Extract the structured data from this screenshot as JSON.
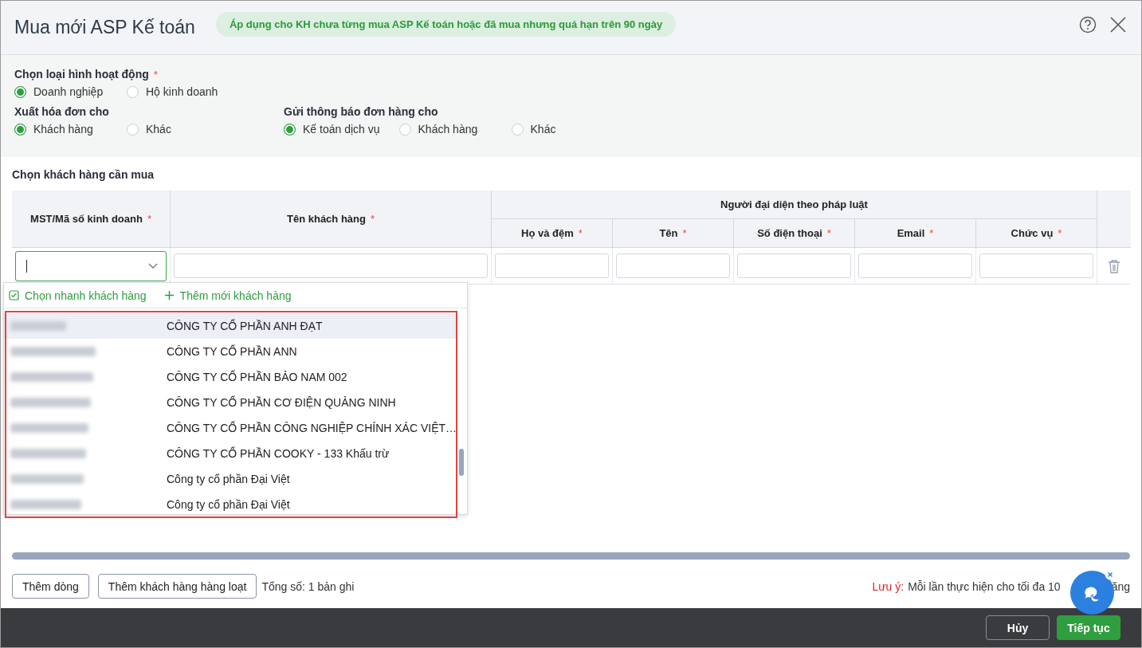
{
  "dialog": {
    "title": "Mua mới ASP Kế toán",
    "notice": "Áp dụng cho KH chưa từng mua ASP Kế toán hoặc đã mua nhưng quá hạn trên 90 ngày"
  },
  "radio_rows": [
    [
      {
        "label": "Chọn loại hình hoạt động",
        "mark": "*",
        "options": [
          {
            "label": "Doanh nghiệp",
            "selected": true
          },
          {
            "label": "Hộ kinh doanh",
            "selected": false
          }
        ]
      }
    ],
    [
      {
        "label": "Xuất hóa đơn cho",
        "options": [
          {
            "label": "Khách hàng",
            "selected": true
          },
          {
            "label": "Khác",
            "selected": false
          }
        ]
      },
      {
        "label": "Gửi thông báo đơn hàng cho",
        "options": [
          {
            "label": "Kế toán dịch vụ",
            "selected": true
          },
          {
            "label": "Khách hàng",
            "selected": false
          },
          {
            "label": "Khác",
            "selected": false
          }
        ]
      }
    ]
  ],
  "section_title": "Chọn khách hàng cần mua",
  "table": {
    "columns": [
      {
        "label": "MST/Mã số kinh doanh",
        "mark": "*"
      },
      {
        "label": "Tên khách hàng",
        "mark": "*"
      }
    ],
    "group": {
      "label": "Người đại diện theo pháp luật",
      "columns": [
        {
          "label": "Họ và đệm",
          "mark": "*"
        },
        {
          "label": "Tên",
          "mark": "*"
        },
        {
          "label": "Số điện thoại",
          "mark": "*"
        },
        {
          "label": "Email",
          "mark": "*"
        },
        {
          "label": "Chức vụ",
          "mark": "*"
        }
      ]
    }
  },
  "dropdown": {
    "actions": [
      {
        "label": "Chọn nhanh khách hàng",
        "kind": "check"
      },
      {
        "label": "Thêm mới khách hàng",
        "kind": "add"
      }
    ],
    "items": [
      {
        "name": "CÔNG TY CỔ PHẦN ANH ĐẠT",
        "selected": true
      },
      {
        "name": "CÔNG TY CỔ PHẦN ANN",
        "selected": false
      },
      {
        "name": "CÔNG TY CỔ PHẦN BẢO NAM 002",
        "selected": false
      },
      {
        "name": "CÔNG TY CỔ PHẦN CƠ ĐIỆN QUẢNG NINH",
        "selected": false
      },
      {
        "name": "CÔNG TY CỔ PHẦN CÔNG NGHIỆP CHÍNH XÁC VIỆT…",
        "selected": false
      },
      {
        "name": "CÔNG TY CỔ PHẦN COOKY - 133 Khấu trừ",
        "selected": false
      },
      {
        "name": "Công ty cổ phần Đại Việt",
        "selected": false
      },
      {
        "name": "Công ty cổ phần Đại Việt",
        "selected": false
      }
    ]
  },
  "buttons": [
    "Thêm dòng",
    "Thêm khách hàng hàng loạt"
  ],
  "total": "Tổng số: 1 bản ghi",
  "note": {
    "label": "Lưu ý:",
    "text": "Mỗi lần thực hiện cho tối đa 10",
    "tail": "ăng"
  },
  "footer": {
    "buttons": [
      {
        "label": "Hủy",
        "kind": "secondary"
      },
      {
        "label": "Tiếp tục",
        "kind": "primary"
      }
    ]
  }
}
